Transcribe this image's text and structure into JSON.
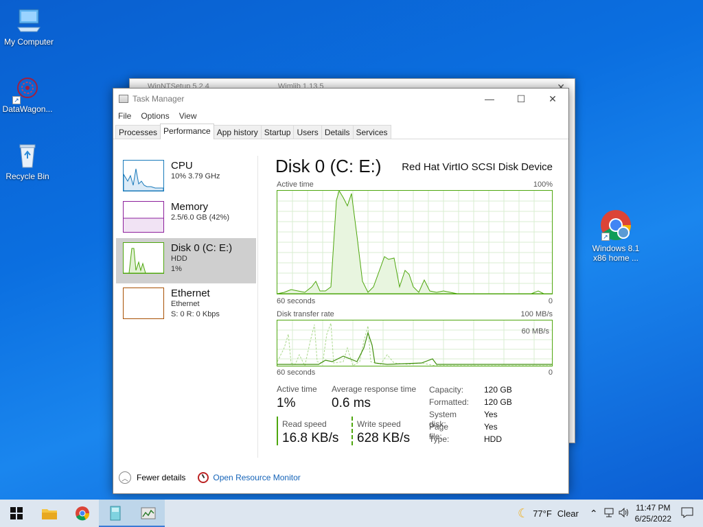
{
  "desktop": {
    "icons": [
      {
        "label": "My Computer"
      },
      {
        "label": "DataWagon..."
      },
      {
        "label": "Recycle Bin"
      },
      {
        "label": "Windows 8.1 x86 home ..."
      }
    ]
  },
  "back_window": {
    "title1": "WinNTSetup 5.2.4",
    "title2": "Wimlib 1.13.5"
  },
  "task_manager": {
    "title": "Task Manager",
    "window_buttons": {
      "minimize": "—",
      "maximize": "☐",
      "close": "✕"
    },
    "menu": [
      "File",
      "Options",
      "View"
    ],
    "tabs": [
      "Processes",
      "Performance",
      "App history",
      "Startup",
      "Users",
      "Details",
      "Services"
    ],
    "active_tab": "Performance",
    "resources": [
      {
        "name": "CPU",
        "line1": "10%  3.79 GHz",
        "line2": ""
      },
      {
        "name": "Memory",
        "line1": "2.5/6.0 GB (42%)",
        "line2": ""
      },
      {
        "name": "Disk 0 (C: E:)",
        "line1": "HDD",
        "line2": "1%"
      },
      {
        "name": "Ethernet",
        "line1": "Ethernet",
        "line2": "S: 0  R: 0 Kbps"
      }
    ],
    "detail": {
      "title": "Disk 0 (C: E:)",
      "device": "Red Hat VirtIO SCSI Disk Device",
      "graph1": {
        "label": "Active time",
        "max": "100%",
        "xlabel": "60 seconds",
        "zero": "0"
      },
      "graph2": {
        "label": "Disk transfer rate",
        "max": "100 MB/s",
        "mid": "60 MB/s",
        "xlabel": "60 seconds",
        "zero": "0"
      },
      "stats": {
        "active_time_label": "Active time",
        "active_time": "1%",
        "avg_resp_label": "Average response time",
        "avg_resp": "0.6 ms",
        "read_label": "Read speed",
        "read": "16.8 KB/s",
        "write_label": "Write speed",
        "write": "628 KB/s"
      },
      "properties": [
        {
          "k": "Capacity:",
          "v": "120 GB"
        },
        {
          "k": "Formatted:",
          "v": "120 GB"
        },
        {
          "k": "System disk:",
          "v": "Yes"
        },
        {
          "k": "Page file:",
          "v": "Yes"
        },
        {
          "k": "Type:",
          "v": "HDD"
        }
      ]
    },
    "footer": {
      "fewer": "Fewer details",
      "monitor": "Open Resource Monitor"
    }
  },
  "taskbar": {
    "weather_temp": "77°F",
    "weather_text": "Clear",
    "time": "11:47 PM",
    "date": "6/25/2022"
  }
}
